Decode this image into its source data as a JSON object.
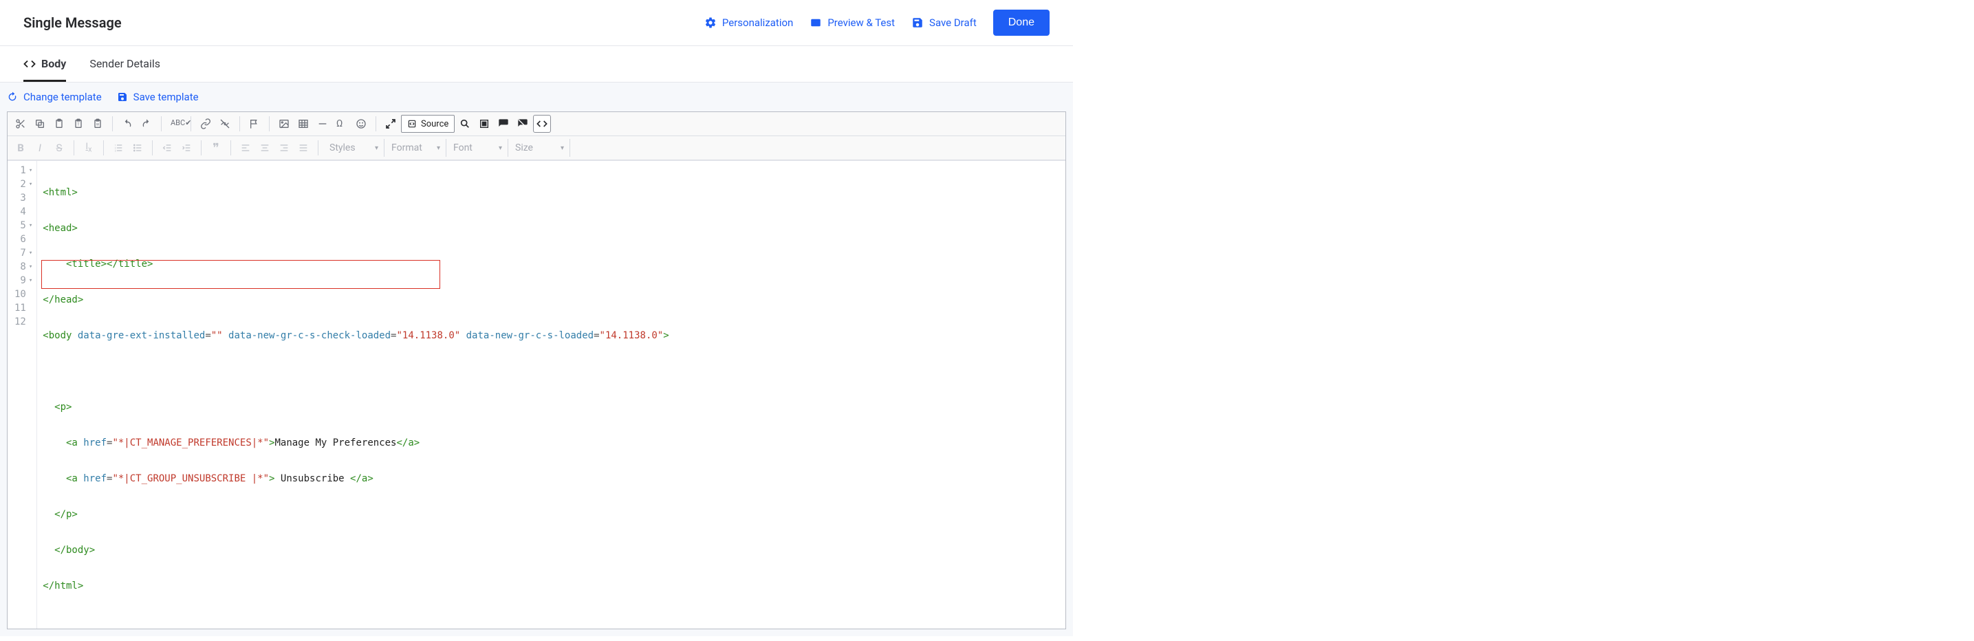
{
  "header": {
    "title": "Single Message",
    "actions": {
      "personalization": "Personalization",
      "preview_test": "Preview & Test",
      "save_draft": "Save Draft",
      "done": "Done"
    }
  },
  "tabs": {
    "body": "Body",
    "sender_details": "Sender Details"
  },
  "subbar": {
    "change_template": "Change template",
    "save_template": "Save template"
  },
  "toolbar": {
    "source_label": "Source",
    "dropdowns": {
      "styles": "Styles",
      "format": "Format",
      "font": "Font",
      "size": "Size"
    }
  },
  "code_lines": {
    "l1": {
      "raw": "<html>"
    },
    "l2": {
      "raw": "<head>"
    },
    "l3": {
      "indent": "    ",
      "open": "<title>",
      "close": "</title>"
    },
    "l4": {
      "raw": "</head>"
    },
    "l5": {
      "open": "<body",
      "attr1_name": " data-gre-ext-installed",
      "attr1_val": "\"\"",
      "attr2_name": " data-new-gr-c-s-check-loaded",
      "attr2_val": "\"14.1138.0\"",
      "attr3_name": " data-new-gr-c-s-loaded",
      "attr3_val": "\"14.1138.0\"",
      "close": ">"
    },
    "l6": {
      "raw": ""
    },
    "l7": {
      "indent": "  ",
      "raw": "<p>"
    },
    "l8": {
      "indent": "    ",
      "open": "<a",
      "attr_name": " href",
      "attr_val": "\"*|CT_MANAGE_PREFERENCES|*\"",
      "close1": ">",
      "text": "Manage My Preferences",
      "close2": "</a>"
    },
    "l9": {
      "indent": "    ",
      "open": "<a",
      "attr_name": " href",
      "attr_val": "\"*|CT_GROUP_UNSUBSCRIBE |*\"",
      "close1": ">",
      "text": " Unsubscribe ",
      "close2": "</a>"
    },
    "l10": {
      "indent": "  ",
      "raw": "</p>"
    },
    "l11": {
      "indent": "  ",
      "raw": "</body>"
    },
    "l12": {
      "raw": "</html>"
    }
  },
  "gutter": {
    "numbers": [
      "1",
      "2",
      "3",
      "4",
      "5",
      "6",
      "7",
      "8",
      "9",
      "10",
      "11",
      "12"
    ],
    "fold_rows": [
      1,
      2,
      5,
      7,
      8,
      9
    ]
  }
}
